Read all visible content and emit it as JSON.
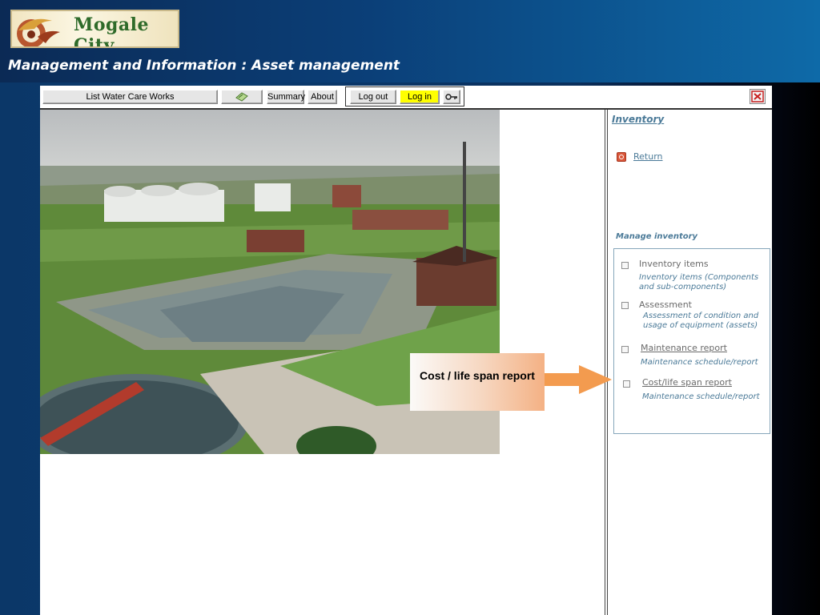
{
  "header": {
    "logo_text": "Mogale City",
    "subtitle": "Management and Information : Asset management"
  },
  "toolbar": {
    "list_label": "List Water Care Works",
    "map_icon": "map-icon",
    "summary_label": "Summary",
    "about_label": "About",
    "logout_label": "Log out",
    "login_label": "Log in",
    "key_icon": "key-icon",
    "close_icon": "close-icon",
    "login_color": "#ffff00"
  },
  "callout": {
    "text": "Cost / life span report",
    "arrow_color": "#f39b4f"
  },
  "sidebar": {
    "inventory_title": "Inventory",
    "return_label": "Return",
    "manage_title": "Manage inventory",
    "items": [
      {
        "label": "Inventory items",
        "desc": "Inventory items (Components and sub-components)",
        "link": false
      },
      {
        "label": "Assessment",
        "desc": "Assessment of condition and usage of equipment (assets)",
        "link": false
      },
      {
        "label": "Maintenance report",
        "desc": "Maintenance schedule/report",
        "link": true
      },
      {
        "label": "Cost/life span report",
        "desc": "Maintenance schedule/report",
        "link": true
      }
    ]
  }
}
